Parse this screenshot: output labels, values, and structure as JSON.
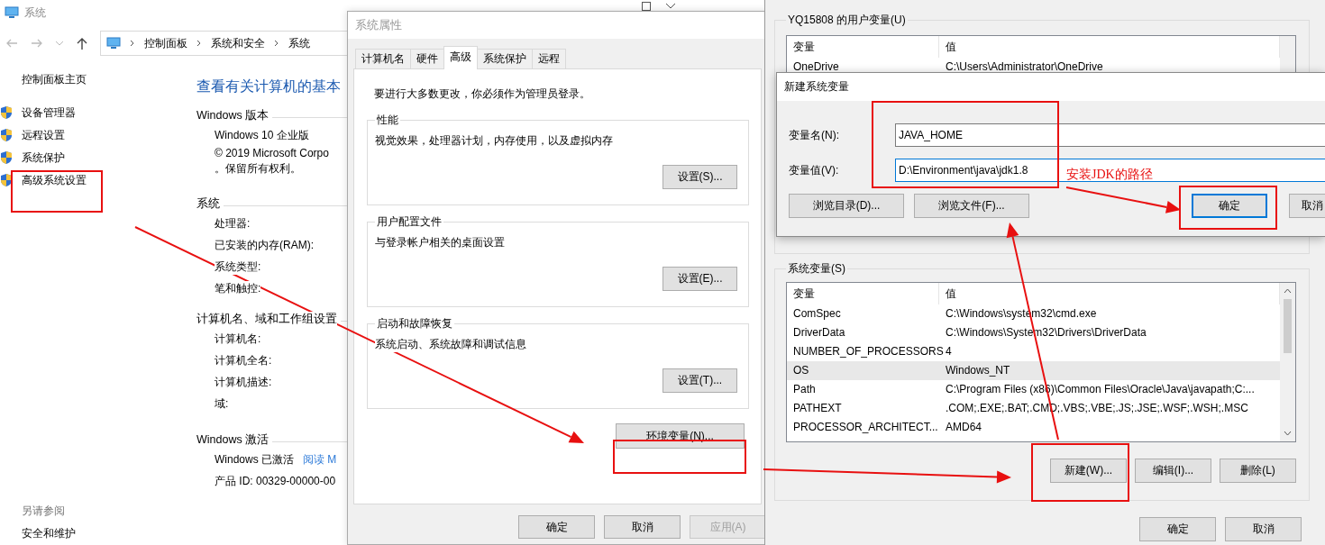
{
  "system_window": {
    "title": "系统",
    "breadcrumb": [
      "控制面板",
      "系统和安全",
      "系统"
    ],
    "sidebar": {
      "home": "控制面板主页",
      "items": [
        {
          "label": "设备管理器"
        },
        {
          "label": "远程设置"
        },
        {
          "label": "系统保护"
        },
        {
          "label": "高级系统设置"
        }
      ],
      "see_also": {
        "heading": "另请参阅",
        "links": [
          "安全和维护"
        ]
      }
    },
    "heading": "查看有关计算机的基本",
    "sections": [
      {
        "title": "Windows 版本",
        "rows": [
          {
            "kind": "text",
            "text": "Windows 10 企业版"
          },
          {
            "kind": "lines",
            "lines": [
              "© 2019 Microsoft Corpo",
              "。保留所有权利。"
            ]
          }
        ]
      },
      {
        "title": "系统",
        "rows": [
          {
            "kind": "text",
            "text": "处理器:"
          },
          {
            "kind": "text",
            "text": "已安装的内存(RAM):"
          },
          {
            "kind": "text",
            "text": "系统类型:"
          },
          {
            "kind": "text",
            "text": "笔和触控:"
          }
        ]
      },
      {
        "title": "计算机名、域和工作组设置",
        "rows": [
          {
            "kind": "text",
            "text": "计算机名:"
          },
          {
            "kind": "text",
            "text": "计算机全名:"
          },
          {
            "kind": "text",
            "text": "计算机描述:"
          },
          {
            "kind": "text",
            "text": "域:"
          }
        ]
      },
      {
        "title": "Windows 激活",
        "rows": [
          {
            "kind": "link",
            "text": "Windows 已激活",
            "link": "阅读 M"
          },
          {
            "kind": "text",
            "text": "产品 ID: 00329-00000-00"
          }
        ]
      }
    ]
  },
  "properties_dialog": {
    "title": "系统属性",
    "tabs": [
      {
        "label": "计算机名",
        "selected": false
      },
      {
        "label": "硬件",
        "selected": false
      },
      {
        "label": "高级",
        "selected": true
      },
      {
        "label": "系统保护",
        "selected": false
      },
      {
        "label": "远程",
        "selected": false
      }
    ],
    "notice": "要进行大多数更改，你必须作为管理员登录。",
    "groups": [
      {
        "title": "性能",
        "description": "视觉效果，处理器计划，内存使用，以及虚拟内存",
        "button": "设置(S)..."
      },
      {
        "title": "用户配置文件",
        "description": "与登录帐户相关的桌面设置",
        "button": "设置(E)..."
      },
      {
        "title": "启动和故障恢复",
        "description": "系统启动、系统故障和调试信息",
        "button": "设置(T)..."
      }
    ],
    "env_button": "环境变量(N)...",
    "buttons": [
      {
        "label": "确定",
        "disabled": false
      },
      {
        "label": "取消",
        "disabled": false
      },
      {
        "label": "应用(A)",
        "disabled": true
      }
    ]
  },
  "env_window": {
    "user_vars": {
      "title": "YQ15808 的用户变量(U)",
      "columns": [
        "变量",
        "值"
      ],
      "rows": [
        {
          "name": "OneDrive",
          "value": "C:\\Users\\Administrator\\OneDrive",
          "selected": false
        }
      ]
    },
    "system_vars": {
      "title": "系统变量(S)",
      "columns": [
        "变量",
        "值"
      ],
      "rows": [
        {
          "name": "ComSpec",
          "value": "C:\\Windows\\system32\\cmd.exe",
          "selected": false
        },
        {
          "name": "DriverData",
          "value": "C:\\Windows\\System32\\Drivers\\DriverData",
          "selected": false
        },
        {
          "name": "NUMBER_OF_PROCESSORS",
          "value": "4",
          "selected": false
        },
        {
          "name": "OS",
          "value": "Windows_NT",
          "selected": true
        },
        {
          "name": "Path",
          "value": "C:\\Program Files (x86)\\Common Files\\Oracle\\Java\\javapath;C:...",
          "selected": false
        },
        {
          "name": "PATHEXT",
          "value": ".COM;.EXE;.BAT;.CMD;.VBS;.VBE;.JS;.JSE;.WSF;.WSH;.MSC",
          "selected": false
        },
        {
          "name": "PROCESSOR_ARCHITECT...",
          "value": "AMD64",
          "selected": false
        }
      ],
      "buttons": [
        "新建(W)...",
        "编辑(I)...",
        "删除(L)"
      ]
    },
    "buttons": [
      "确定",
      "取消"
    ]
  },
  "new_variable_dialog": {
    "title": "新建系统变量",
    "fields": [
      {
        "label": "变量名(N):",
        "value": "JAVA_HOME",
        "focused": false
      },
      {
        "label": "变量值(V):",
        "value": "D:\\Environment\\java\\jdk1.8",
        "focused": true
      }
    ],
    "buttons": [
      {
        "label": "浏览目录(D)...",
        "default": false
      },
      {
        "label": "浏览文件(F)...",
        "default": false
      },
      {
        "label": "确定",
        "default": true
      },
      {
        "label": "取消",
        "default": false
      }
    ]
  },
  "annotation": {
    "note": "安装JDK的路径"
  }
}
